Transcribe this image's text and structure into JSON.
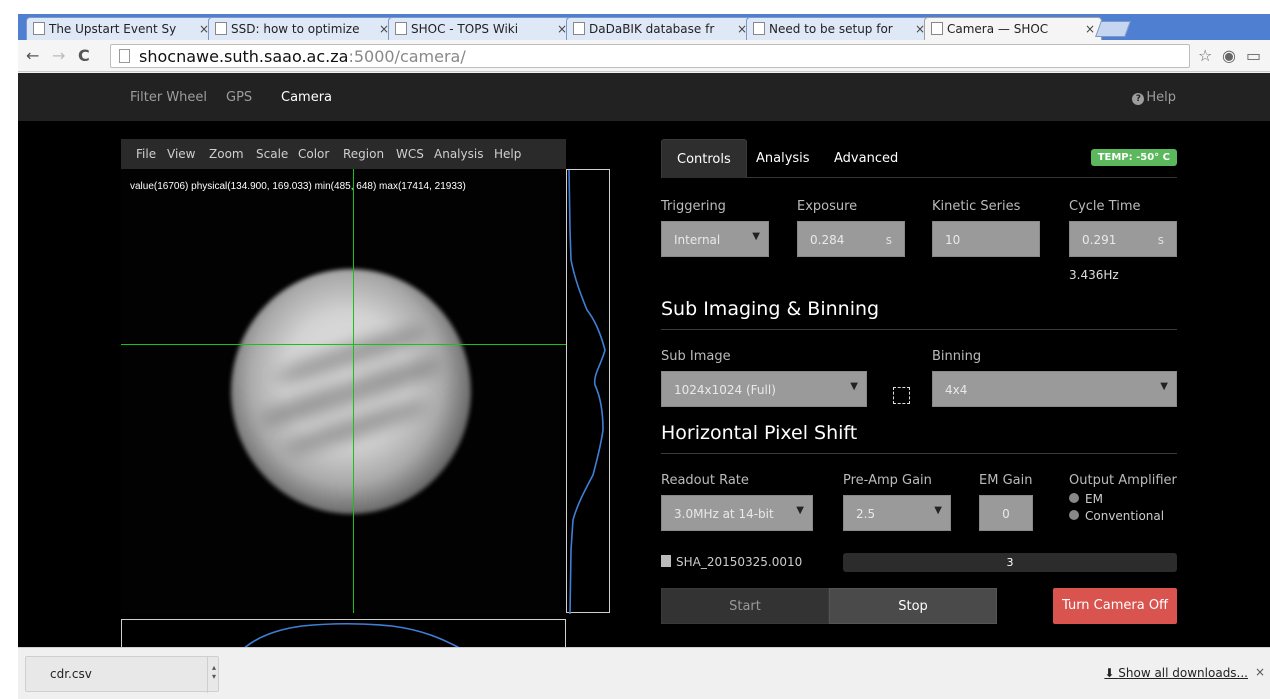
{
  "browser": {
    "tabs": [
      {
        "label": "The Upstart Event Sy"
      },
      {
        "label": "SSD: how to optimize"
      },
      {
        "label": "SHOC - TOPS Wiki"
      },
      {
        "label": "DaDaBIK database fr"
      },
      {
        "label": "Need to be setup for"
      },
      {
        "label": "Camera — SHOC"
      }
    ],
    "url_host": "shocnawe.suth.saao.ac.za",
    "url_rest": ":5000/camera/"
  },
  "navbar": {
    "items": [
      "Filter Wheel",
      "GPS",
      "Camera"
    ],
    "help": "Help"
  },
  "viewer": {
    "menu": [
      "File",
      "View",
      "Zoom",
      "Scale",
      "Color",
      "Region",
      "WCS",
      "Analysis",
      "Help"
    ],
    "readout": "value(16706) physical(134.900, 169.033) min(485, 648) max(17414, 21933)"
  },
  "panel": {
    "tabs": [
      "Controls",
      "Analysis",
      "Advanced"
    ],
    "temp": "TEMP: -50° C",
    "triggering": {
      "label": "Triggering",
      "value": "Internal"
    },
    "exposure": {
      "label": "Exposure",
      "value": "0.284",
      "unit": "s"
    },
    "kinetic": {
      "label": "Kinetic Series",
      "value": "10"
    },
    "cycle": {
      "label": "Cycle Time",
      "value": "0.291",
      "unit": "s",
      "freq": "3.436Hz"
    },
    "sub_imaging_title": "Sub Imaging & Binning",
    "sub_image": {
      "label": "Sub Image",
      "value": "1024x1024 (Full)"
    },
    "binning": {
      "label": "Binning",
      "value": "4x4"
    },
    "hps_title": "Horizontal Pixel Shift",
    "readout_rate": {
      "label": "Readout Rate",
      "value": "3.0MHz at 14-bit"
    },
    "preamp": {
      "label": "Pre-Amp Gain",
      "value": "2.5"
    },
    "emgain": {
      "label": "EM Gain",
      "value": "0"
    },
    "output_amp": {
      "label": "Output Amplifier",
      "options": [
        "EM",
        "Conventional"
      ]
    },
    "filename": "SHA_20150325.0010",
    "progress_text": "3",
    "start": "Start",
    "stop": "Stop",
    "camera_off": "Turn Camera Off"
  },
  "downloads": {
    "file": "cdr.csv",
    "show_all": "Show all downloads..."
  }
}
